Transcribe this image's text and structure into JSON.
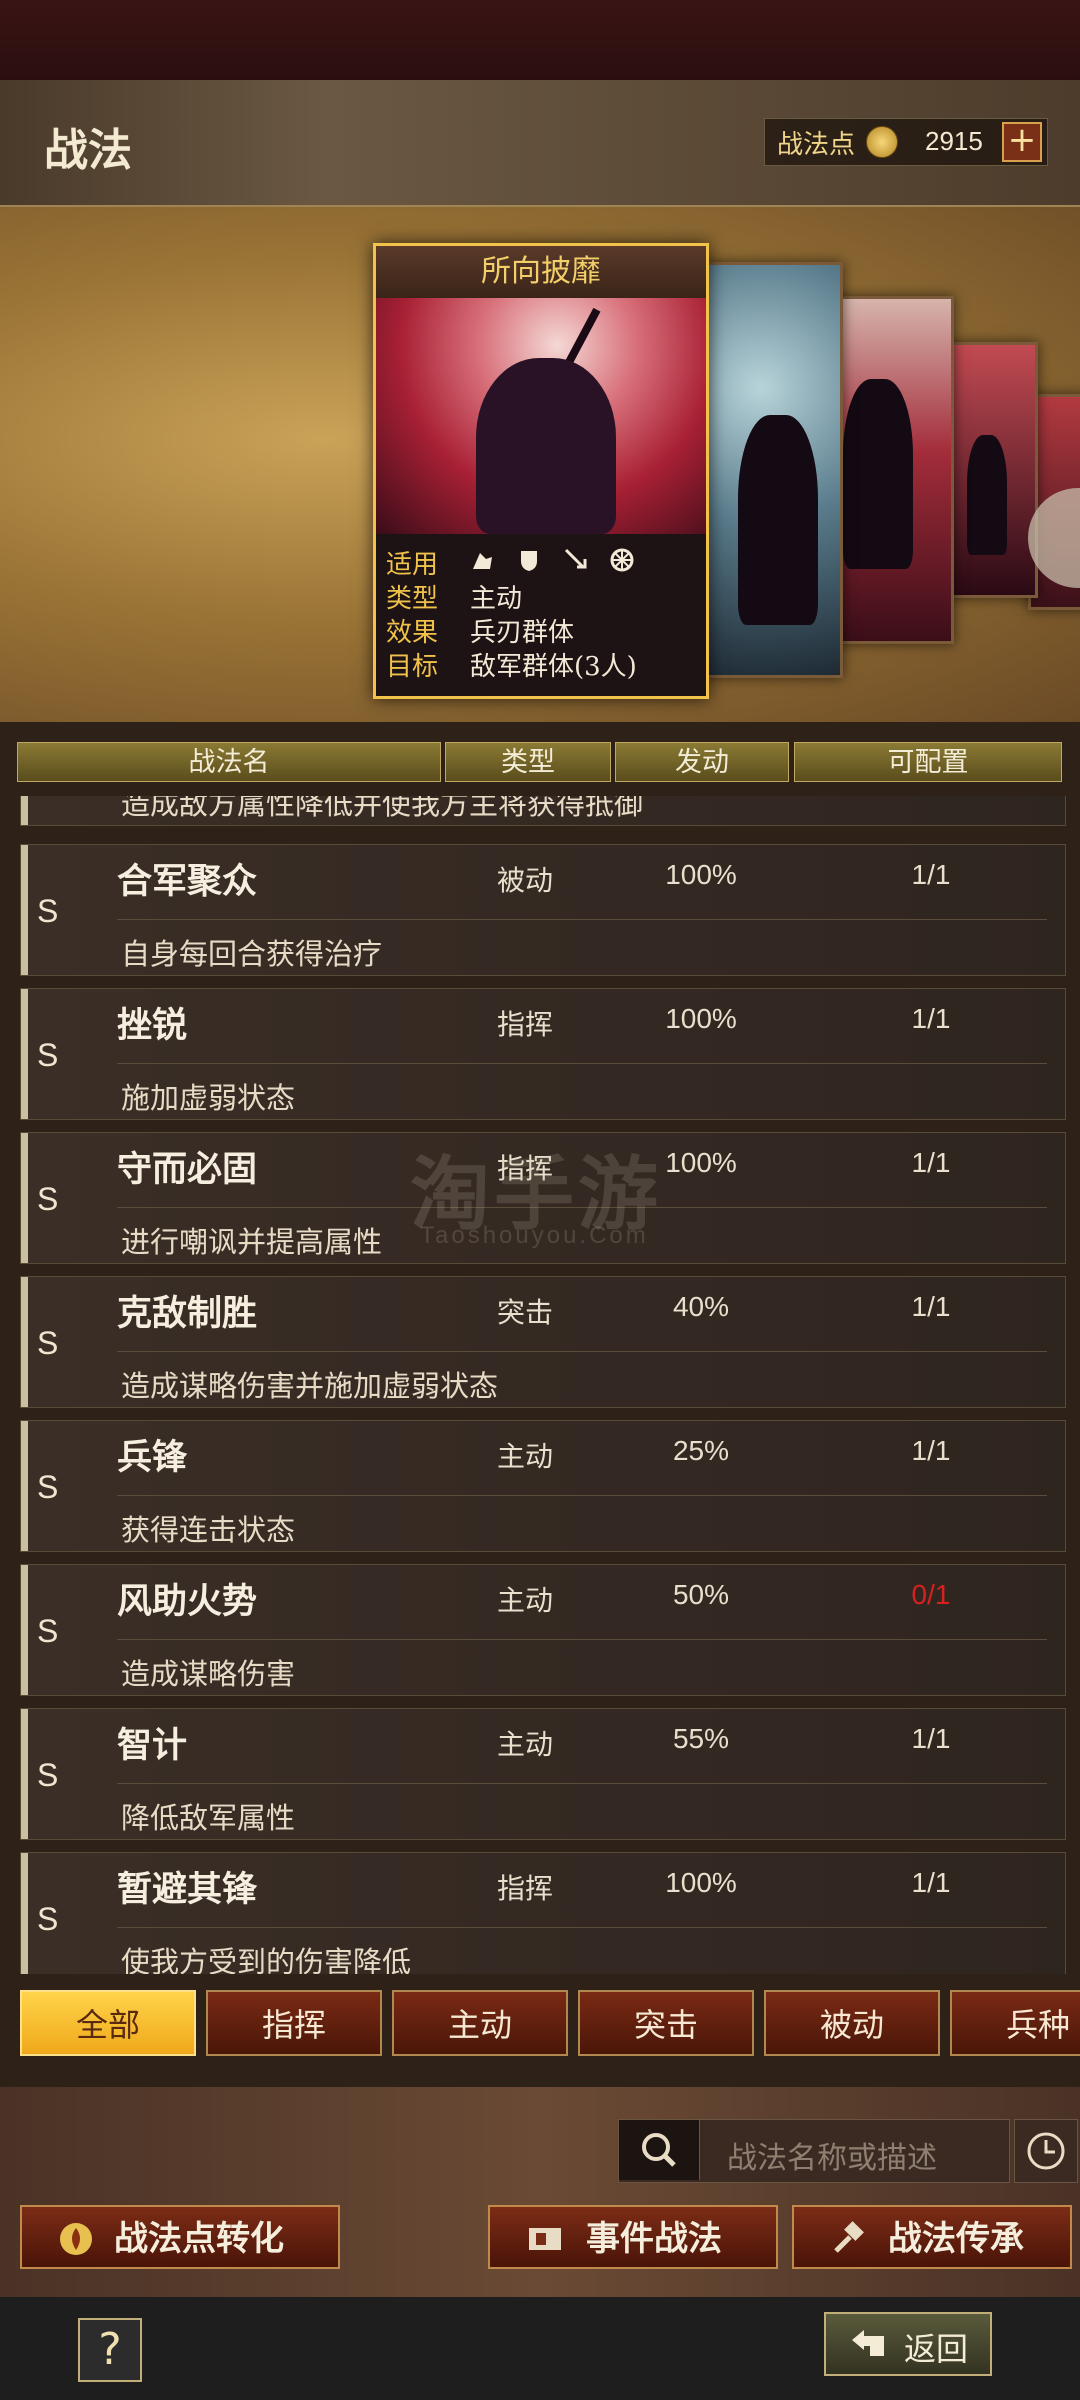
{
  "header": {
    "title": "战法",
    "points_label": "战法点",
    "points_value": "2915",
    "plus": "+"
  },
  "featured_card": {
    "title": "所向披靡",
    "fields": [
      {
        "key": "适用",
        "icons": [
          "cavalry-icon",
          "shield-icon",
          "bow-icon",
          "wheel-icon"
        ]
      },
      {
        "key": "类型",
        "value": "主动"
      },
      {
        "key": "效果",
        "value": "兵刃群体"
      },
      {
        "key": "目标",
        "value": "敌军群体(3人)"
      }
    ]
  },
  "columns": [
    "战法名",
    "类型",
    "发动",
    "可配置"
  ],
  "partial_row_desc": "造成敌方属性降低并使我方主将获得抵御",
  "rows": [
    {
      "grade": "S",
      "name": "合军聚众",
      "type": "被动",
      "rate": "100%",
      "config": "1/1",
      "config_red": false,
      "desc": "自身每回合获得治疗"
    },
    {
      "grade": "S",
      "name": "挫锐",
      "type": "指挥",
      "rate": "100%",
      "config": "1/1",
      "config_red": false,
      "desc": "施加虚弱状态"
    },
    {
      "grade": "S",
      "name": "守而必固",
      "type": "指挥",
      "rate": "100%",
      "config": "1/1",
      "config_red": false,
      "desc": "进行嘲讽并提高属性"
    },
    {
      "grade": "S",
      "name": "克敌制胜",
      "type": "突击",
      "rate": "40%",
      "config": "1/1",
      "config_red": false,
      "desc": "造成谋略伤害并施加虚弱状态"
    },
    {
      "grade": "S",
      "name": "兵锋",
      "type": "主动",
      "rate": "25%",
      "config": "1/1",
      "config_red": false,
      "desc": "获得连击状态"
    },
    {
      "grade": "S",
      "name": "风助火势",
      "type": "主动",
      "rate": "50%",
      "config": "0/1",
      "config_red": true,
      "desc": "造成谋略伤害"
    },
    {
      "grade": "S",
      "name": "智计",
      "type": "主动",
      "rate": "55%",
      "config": "1/1",
      "config_red": false,
      "desc": "降低敌军属性"
    },
    {
      "grade": "S",
      "name": "暂避其锋",
      "type": "指挥",
      "rate": "100%",
      "config": "1/1",
      "config_red": false,
      "desc": "使我方受到的伤害降低"
    }
  ],
  "filters": [
    "全部",
    "指挥",
    "主动",
    "突击",
    "被动",
    "兵种"
  ],
  "watermark": {
    "main": "淘手游",
    "sub": "Taoshouyou.Com"
  },
  "search": {
    "placeholder": "战法名称或描述"
  },
  "buttons": {
    "convert": "战法点转化",
    "event": "事件战法",
    "inherit": "战法传承"
  },
  "footer": {
    "help": "?",
    "back": "返回"
  },
  "colors": {
    "gold": "#f2c24a",
    "active_tab": "#ffd44a",
    "red_config": "#d82020"
  }
}
